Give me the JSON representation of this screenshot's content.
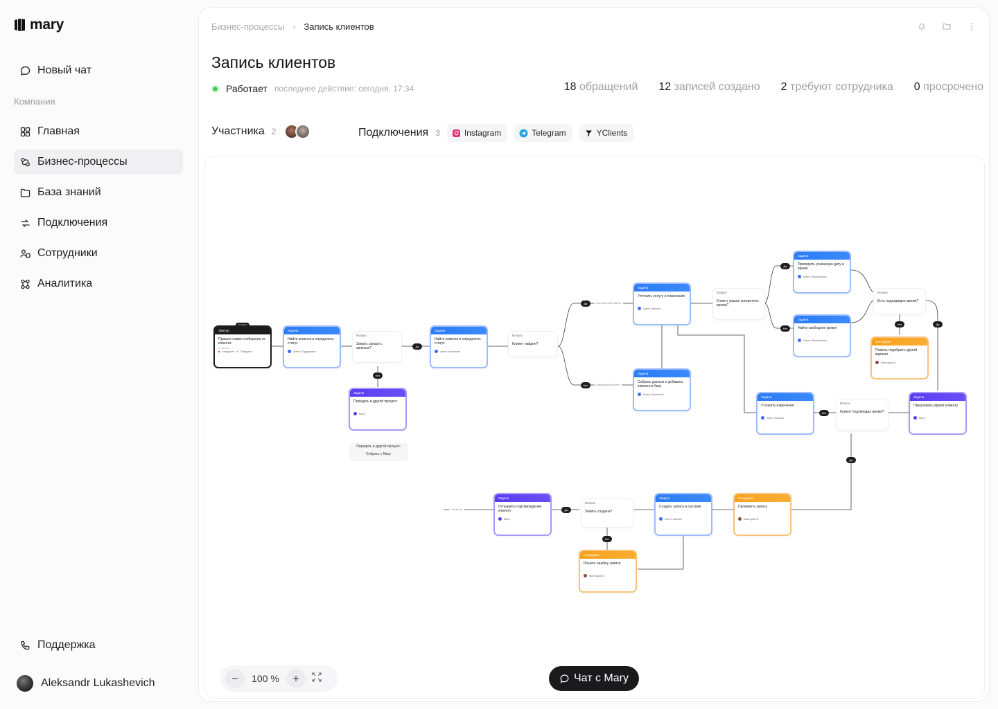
{
  "app": {
    "name": "mary"
  },
  "sidebar": {
    "new_chat": "Новый чат",
    "section": "Компания",
    "items": [
      {
        "label": "Главная",
        "icon": "grid-icon"
      },
      {
        "label": "Бизнес-процессы",
        "icon": "process-icon"
      },
      {
        "label": "База знаний",
        "icon": "folder-icon"
      },
      {
        "label": "Подключения",
        "icon": "connections-icon"
      },
      {
        "label": "Сотрудники",
        "icon": "users-icon"
      },
      {
        "label": "Аналитика",
        "icon": "analytics-icon"
      }
    ],
    "active": "Бизнес-процессы",
    "support": "Поддержка",
    "user": "Aleksandr Lukashevich"
  },
  "breadcrumb": {
    "parent": "Бизнес-процессы",
    "current": "Запись клиентов"
  },
  "page": {
    "title": "Запись клиентов",
    "status": "Работает",
    "last_action": "последнее действие: сегодня, 17:34"
  },
  "stats": [
    {
      "value": "18",
      "label": "обращений"
    },
    {
      "value": "12",
      "label": "записей создано"
    },
    {
      "value": "2",
      "label": "требуют сотрудника"
    },
    {
      "value": "0",
      "label": "просрочено"
    }
  ],
  "participants": {
    "label": "Участника",
    "count": "2"
  },
  "connections": {
    "label": "Подключения",
    "count": "3",
    "items": [
      "Instagram",
      "Telegram",
      "YClients"
    ]
  },
  "flow": {
    "start": "Старт",
    "trigger": {
      "type": "Триггер",
      "text": "Пришло новое сообщение от клиента",
      "meta": "2 канала",
      "ch1": "Instagram",
      "ch2": "Telegram"
    },
    "n1": {
      "type": "Задача",
      "text": "Найти клиента и определить статус",
      "agent": "Агент-Поддержки"
    },
    "q1": {
      "type": "Вопрос",
      "text": "Запрос связан с записью?"
    },
    "n2": {
      "type": "Задача",
      "text": "Найти клиента и определить статус",
      "agent": "Агент-Клиентов"
    },
    "q2": {
      "type": "Вопрос",
      "text": "Клиент найден?"
    },
    "n3": {
      "type": "Задача",
      "text": "Передать в другой процесс",
      "agent": "Mary"
    },
    "sub1": "Передать в другой процесс",
    "sub2": "Собрать с Mary",
    "n4": {
      "type": "Задача",
      "text": "Уточнить услугу и пожелания",
      "agent": "Агент-Записи"
    },
    "n5": {
      "type": "Задача",
      "text": "Собрать данные и добавить клиента в базу",
      "agent": "Агент-Клиентов"
    },
    "q3": {
      "type": "Вопрос",
      "text": "Клиент указал конкретное время?"
    },
    "n6": {
      "type": "Задача",
      "text": "Проверить указанную дату и время",
      "agent": "Агент-Расписания"
    },
    "n7": {
      "type": "Задача",
      "text": "Найти свободное время",
      "agent": "Агент-Расписания"
    },
    "q4": {
      "type": "Вопрос",
      "text": "Есть подходящее время?"
    },
    "n8": {
      "type": "Сотрудник",
      "text": "Помочь подобрать другой вариант",
      "agent": "Виктория Б."
    },
    "n9": {
      "type": "Задача",
      "text": "Уточнить изменения",
      "agent": "Агент-Записи"
    },
    "q5": {
      "type": "Вопрос",
      "text": "Клиент подтвердил время?"
    },
    "n10": {
      "type": "Задача",
      "text": "Предложить время клиенту",
      "agent": "Mary"
    },
    "n11": {
      "type": "Сотрудник",
      "text": "Проверить запись",
      "agent": "Виктория Б."
    },
    "n12": {
      "type": "Задача",
      "text": "Создать запись в системе",
      "agent": "Агент-Записи"
    },
    "q6": {
      "type": "Вопрос",
      "text": "Запись создана?"
    },
    "n13": {
      "type": "Задача",
      "text": "Отправить подтверждение клиенту",
      "agent": "Mary"
    },
    "n14": {
      "type": "Сотрудник",
      "text": "Решить ошибку записи",
      "agent": "Виктория Б."
    },
    "done": "Готово",
    "yes": "Да",
    "no": "Нет",
    "label_regular": "Постоянный клиент",
    "label_new": "Первичный клиент"
  },
  "controls": {
    "zoom": "100 %",
    "chat": "Чат с Mary"
  },
  "colors": {
    "task": "#2b7cf6",
    "mary": "#5b3df0",
    "staff": "#f7a11a",
    "trigger": "#1c1c1e",
    "status": "#39d353"
  }
}
